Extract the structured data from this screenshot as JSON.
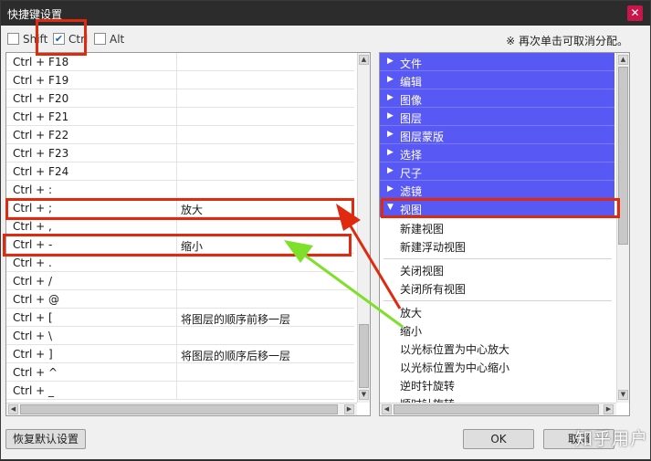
{
  "window": {
    "title": "快捷键设置",
    "close_label": "✕"
  },
  "modifiers": [
    {
      "label": "Shift",
      "checked": false
    },
    {
      "label": "Ctrl",
      "checked": true
    },
    {
      "label": "Alt",
      "checked": false
    }
  ],
  "hint": "※ 再次单击可取消分配。",
  "shortcuts": [
    {
      "key": "Ctrl + F18",
      "command": ""
    },
    {
      "key": "Ctrl + F19",
      "command": ""
    },
    {
      "key": "Ctrl + F20",
      "command": ""
    },
    {
      "key": "Ctrl + F21",
      "command": ""
    },
    {
      "key": "Ctrl + F22",
      "command": ""
    },
    {
      "key": "Ctrl + F23",
      "command": ""
    },
    {
      "key": "Ctrl + F24",
      "command": ""
    },
    {
      "key": "Ctrl + :",
      "command": ""
    },
    {
      "key": "Ctrl + ;",
      "command": "放大"
    },
    {
      "key": "Ctrl + ,",
      "command": ""
    },
    {
      "key": "Ctrl + -",
      "command": "缩小"
    },
    {
      "key": "Ctrl + .",
      "command": ""
    },
    {
      "key": "Ctrl + /",
      "command": ""
    },
    {
      "key": "Ctrl + @",
      "command": ""
    },
    {
      "key": "Ctrl + [",
      "command": "将图层的顺序前移一层"
    },
    {
      "key": "Ctrl + \\",
      "command": ""
    },
    {
      "key": "Ctrl + ]",
      "command": "将图层的顺序后移一层"
    },
    {
      "key": "Ctrl + ^",
      "command": ""
    },
    {
      "key": "Ctrl + _",
      "command": ""
    }
  ],
  "categories": [
    {
      "label": "文件",
      "expanded": false
    },
    {
      "label": "编辑",
      "expanded": false
    },
    {
      "label": "图像",
      "expanded": false
    },
    {
      "label": "图层",
      "expanded": false
    },
    {
      "label": "图层蒙版",
      "expanded": false
    },
    {
      "label": "选择",
      "expanded": false
    },
    {
      "label": "尺子",
      "expanded": false
    },
    {
      "label": "滤镜",
      "expanded": false
    },
    {
      "label": "视图",
      "expanded": true
    }
  ],
  "view_commands": [
    [
      "新建视图",
      "新建浮动视图"
    ],
    [
      "关闭视图",
      "关闭所有视图"
    ],
    [
      "放大",
      "缩小",
      "以光标位置为中心放大",
      "以光标位置为中心缩小",
      "逆时针旋转",
      "顺时针旋转"
    ]
  ],
  "buttons": {
    "reset": "恢复默认设置",
    "ok": "OK",
    "cancel": "取消"
  },
  "watermark": "知乎用户",
  "colors": {
    "category_bg": "#5858f5",
    "highlight": "#e02a10",
    "arrow_green": "#7ee02a",
    "titlebar": "#2c2c2c"
  }
}
